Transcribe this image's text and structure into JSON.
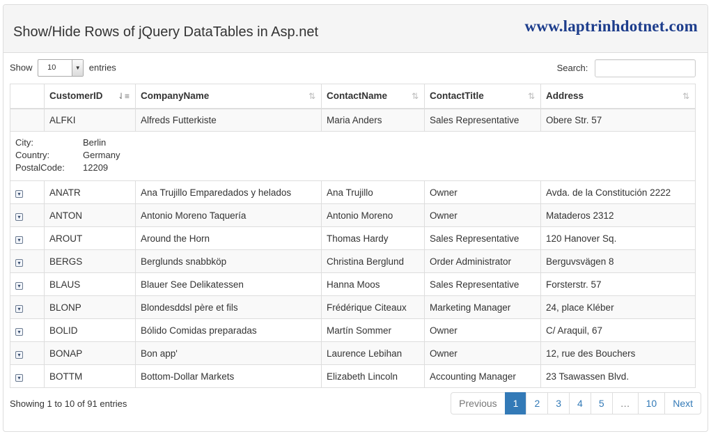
{
  "header": {
    "title": "Show/Hide Rows of jQuery DataTables in Asp.net",
    "brand": "www.laptrinhdotnet.com",
    "brand_color": "#1d3d8c"
  },
  "length": {
    "show_label": "Show",
    "value": "10",
    "entries_label": "entries"
  },
  "search": {
    "label": "Search:",
    "value": "",
    "placeholder": ""
  },
  "table": {
    "columns": [
      "CustomerID",
      "CompanyName",
      "ContactName",
      "ContactTitle",
      "Address"
    ],
    "expanded_row": {
      "cells": [
        "ALFKI",
        "Alfreds Futterkiste",
        "Maria Anders",
        "Sales Representative",
        "Obere Str. 57"
      ],
      "details": [
        {
          "key": "City:",
          "value": "Berlin"
        },
        {
          "key": "Country:",
          "value": "Germany"
        },
        {
          "key": "PostalCode:",
          "value": "12209"
        }
      ]
    },
    "rows": [
      [
        "ANATR",
        "Ana Trujillo Emparedados y helados",
        "Ana Trujillo",
        "Owner",
        "Avda. de la Constitución 2222"
      ],
      [
        "ANTON",
        "Antonio Moreno Taquería",
        "Antonio Moreno",
        "Owner",
        "Mataderos 2312"
      ],
      [
        "AROUT",
        "Around the Horn",
        "Thomas Hardy",
        "Sales Representative",
        "120 Hanover Sq."
      ],
      [
        "BERGS",
        "Berglunds snabbköp",
        "Christina Berglund",
        "Order Administrator",
        "Berguvsvägen 8"
      ],
      [
        "BLAUS",
        "Blauer See Delikatessen",
        "Hanna Moos",
        "Sales Representative",
        "Forsterstr. 57"
      ],
      [
        "BLONP",
        "Blondesddsl père et fils",
        "Frédérique Citeaux",
        "Marketing Manager",
        "24, place Kléber"
      ],
      [
        "BOLID",
        "Bólido Comidas preparadas",
        "Martín Sommer",
        "Owner",
        "C/ Araquil, 67"
      ],
      [
        "BONAP",
        "Bon app'",
        "Laurence Lebihan",
        "Owner",
        "12, rue des Bouchers"
      ],
      [
        "BOTTM",
        "Bottom-Dollar Markets",
        "Elizabeth Lincoln",
        "Accounting Manager",
        "23 Tsawassen Blvd."
      ]
    ]
  },
  "info": "Showing 1 to 10 of 91 entries",
  "pagination": {
    "previous": "Previous",
    "pages": [
      "1",
      "2",
      "3",
      "4",
      "5",
      "…",
      "10"
    ],
    "active": "1",
    "next": "Next",
    "active_color": "#337ab7"
  }
}
